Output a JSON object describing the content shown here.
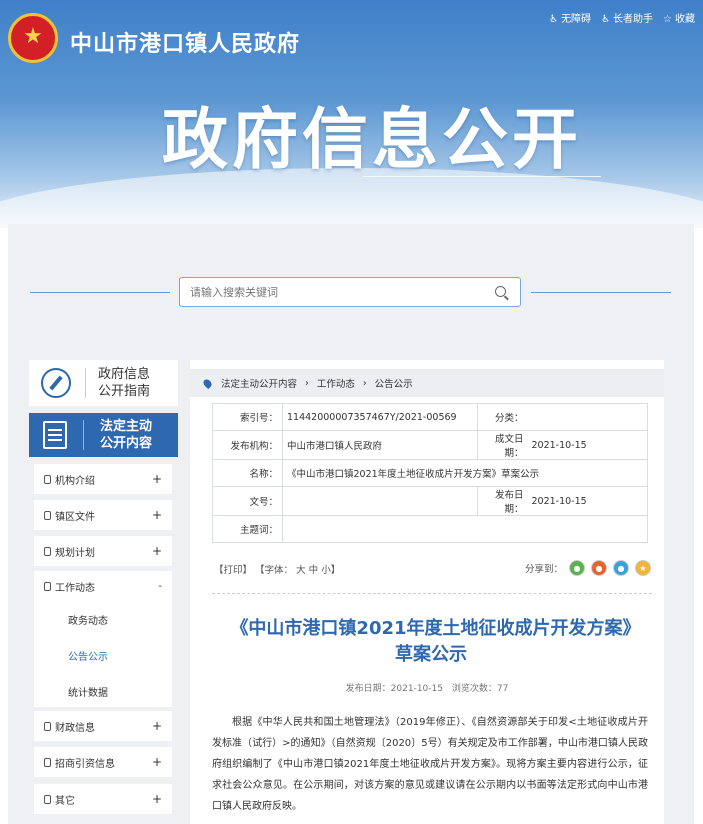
{
  "header": {
    "site_title": "中山市港口镇人民政府",
    "links": [
      {
        "icon": "accessibility-icon",
        "label": "无障碍"
      },
      {
        "icon": "elder-assist-icon",
        "label": "长者助手"
      },
      {
        "icon": "star-icon",
        "label": "收藏"
      }
    ],
    "banner_title": "政府信息公开"
  },
  "search": {
    "placeholder": "请输入搜索关键词"
  },
  "sidebar": {
    "guide_label_1": "政府信息",
    "guide_label_2": "公开指南",
    "active_label_1": "法定主动",
    "active_label_2": "公开内容",
    "items": [
      {
        "label": "机构介绍",
        "toggle": "+"
      },
      {
        "label": "镇区文件",
        "toggle": "+"
      },
      {
        "label": "规划计划",
        "toggle": "+"
      },
      {
        "label": "工作动态",
        "toggle": "-"
      },
      {
        "label": "财政信息",
        "toggle": "+"
      },
      {
        "label": "招商引资信息",
        "toggle": "+"
      },
      {
        "label": "其它",
        "toggle": "+"
      }
    ],
    "subitems": [
      "政务动态",
      "公告公示",
      "统计数据"
    ]
  },
  "breadcrumb": [
    "法定主动公开内容",
    "工作动态",
    "公告公示"
  ],
  "meta": {
    "index_label": "索引号：",
    "index_value": "11442000007357467Y/2021-00569",
    "category_label": "分类：",
    "category_value": "",
    "org_label": "发布机构：",
    "org_value": "中山市港口镇人民政府",
    "created_label": "成文日期：",
    "created_value": "2021-10-15",
    "name_label": "名称：",
    "name_value": "《中山市港口镇2021年度土地征收成片开发方案》草案公示",
    "docno_label": "文号：",
    "docno_value": "",
    "pubdate_label": "发布日期：",
    "pubdate_value": "2021-10-15",
    "topic_label": "主题词：",
    "topic_value": ""
  },
  "tools": {
    "print": "【打印】",
    "font": "【字体：",
    "font_large": "大",
    "font_medium": "中",
    "font_small": "小",
    "font_end": "】",
    "share_label": "分享到："
  },
  "article": {
    "title": "《中山市港口镇2021年度土地征收成片开发方案》草案公示",
    "pub_label": "发布日期：",
    "pub_date": "2021-10-15",
    "views_label": "浏览次数：",
    "views": "77",
    "body": "根据《中华人民共和国土地管理法》（2019年修正）、《自然资源部关于印发<土地征收成片开发标准（试行）>的通知》（自然资规〔2020〕5号）有关规定及市工作部署，中山市港口镇人民政府组织编制了《中山市港口镇2021年度土地征收成片开发方案》。现将方案主要内容进行公示，征求社会公众意见。在公示期间，对该方案的意见或建议请在公示期内以书面等法定形式向中山市港口镇人民政府反映。"
  },
  "colors": {
    "primary": "#2d68b0",
    "share_wechat": "#5bb04f",
    "share_weibo": "#e8622c",
    "share_qq": "#3aa0e0",
    "share_qzone": "#f1b53a"
  }
}
